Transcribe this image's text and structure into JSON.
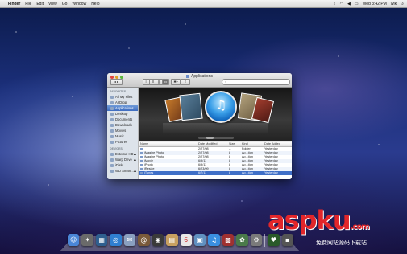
{
  "menubar": {
    "apple": "",
    "items": [
      "Finder",
      "File",
      "Edit",
      "View",
      "Go",
      "Window",
      "Help"
    ],
    "clock": "Wed 3:42 PM",
    "user": "wiki"
  },
  "window": {
    "title": "Applications",
    "search_placeholder": "",
    "toolbar": {
      "nav": "◂ ▸",
      "view_icon": "≡",
      "view_list": "☰",
      "view_column": "▥",
      "view_flow": "▭",
      "action": "✱▾",
      "share": "⇪"
    }
  },
  "sidebar": {
    "favorites_header": "FAVORITES",
    "favorites": [
      "All My Files",
      "AirDrop",
      "Applications",
      "Desktop",
      "Documents",
      "Downloads",
      "Movies",
      "Music",
      "Pictures"
    ],
    "selected_index": 2,
    "devices_header": "DEVICES",
    "devices": [
      "External HD",
      "Warp Drive",
      "iDisk",
      "WD Smart..."
    ]
  },
  "list": {
    "headers": {
      "name": "Name",
      "date": "Date Modified",
      "size": "Size",
      "kind": "Kind",
      "added": "Date Added"
    },
    "rows": [
      {
        "name": "",
        "date": "2/27/08",
        "size": "--",
        "kind": "Folder",
        "added": "Yesterday"
      },
      {
        "name": "iMagine Photo",
        "date": "2/27/08",
        "size": "8",
        "kind": "Ap...tion",
        "added": "Yesterday"
      },
      {
        "name": "iMagine Photo",
        "date": "2/27/08",
        "size": "8",
        "kind": "Ap...tion",
        "added": "Yesterday"
      },
      {
        "name": "iMovie",
        "date": "6/9/11",
        "size": "8",
        "kind": "Ap...tion",
        "added": "Yesterday"
      },
      {
        "name": "iPhoto",
        "date": "6/9/11",
        "size": "8",
        "kind": "Ap...tion",
        "added": "Yesterday"
      },
      {
        "name": "iResize",
        "date": "6/23/09",
        "size": "8",
        "kind": "Ap...tion",
        "added": "Yesterday"
      },
      {
        "name": "iTunes",
        "date": "6/7/11",
        "size": "8",
        "kind": "Ap...tion",
        "added": "Yesterday"
      }
    ],
    "selected_index": 6
  },
  "preview": {
    "note": "♫"
  },
  "watermark": {
    "logo": "aspku",
    "logo_suffix": ".com",
    "tagline": "免费网站源码下载站!"
  },
  "dock": {
    "icons": [
      {
        "name": "finder-icon",
        "glyph": "☺",
        "color": "#4a86d6"
      },
      {
        "name": "launchpad-icon",
        "glyph": "✦",
        "color": "#6a6a6a"
      },
      {
        "name": "mission-control-icon",
        "glyph": "▦",
        "color": "#2f5f8f"
      },
      {
        "name": "safari-icon",
        "glyph": "◎",
        "color": "#2f7fd0"
      },
      {
        "name": "mail-icon",
        "glyph": "✉",
        "color": "#8aa0c0"
      },
      {
        "name": "contacts-icon",
        "glyph": "@",
        "color": "#7a5a3a"
      },
      {
        "name": "facetime-icon",
        "glyph": "◉",
        "color": "#3a3a3a"
      },
      {
        "name": "address-book-icon",
        "glyph": "▤",
        "color": "#c8a060"
      },
      {
        "name": "calendar-icon",
        "glyph": "6",
        "color": "#e8e8e8"
      },
      {
        "name": "preview-icon",
        "glyph": "▣",
        "color": "#6090c0"
      },
      {
        "name": "itunes-icon",
        "glyph": "♫",
        "color": "#3a8fe0"
      },
      {
        "name": "photobooth-icon",
        "glyph": "▩",
        "color": "#a03030"
      },
      {
        "name": "iphoto-icon",
        "glyph": "✿",
        "color": "#4a7a4a"
      },
      {
        "name": "system-prefs-icon",
        "glyph": "⚙",
        "color": "#7a7a7a"
      },
      {
        "name": "activity-monitor-icon",
        "glyph": "♥",
        "color": "#2a5a2a"
      },
      {
        "name": "utilities-icon",
        "glyph": "▪",
        "color": "#555555"
      }
    ]
  }
}
